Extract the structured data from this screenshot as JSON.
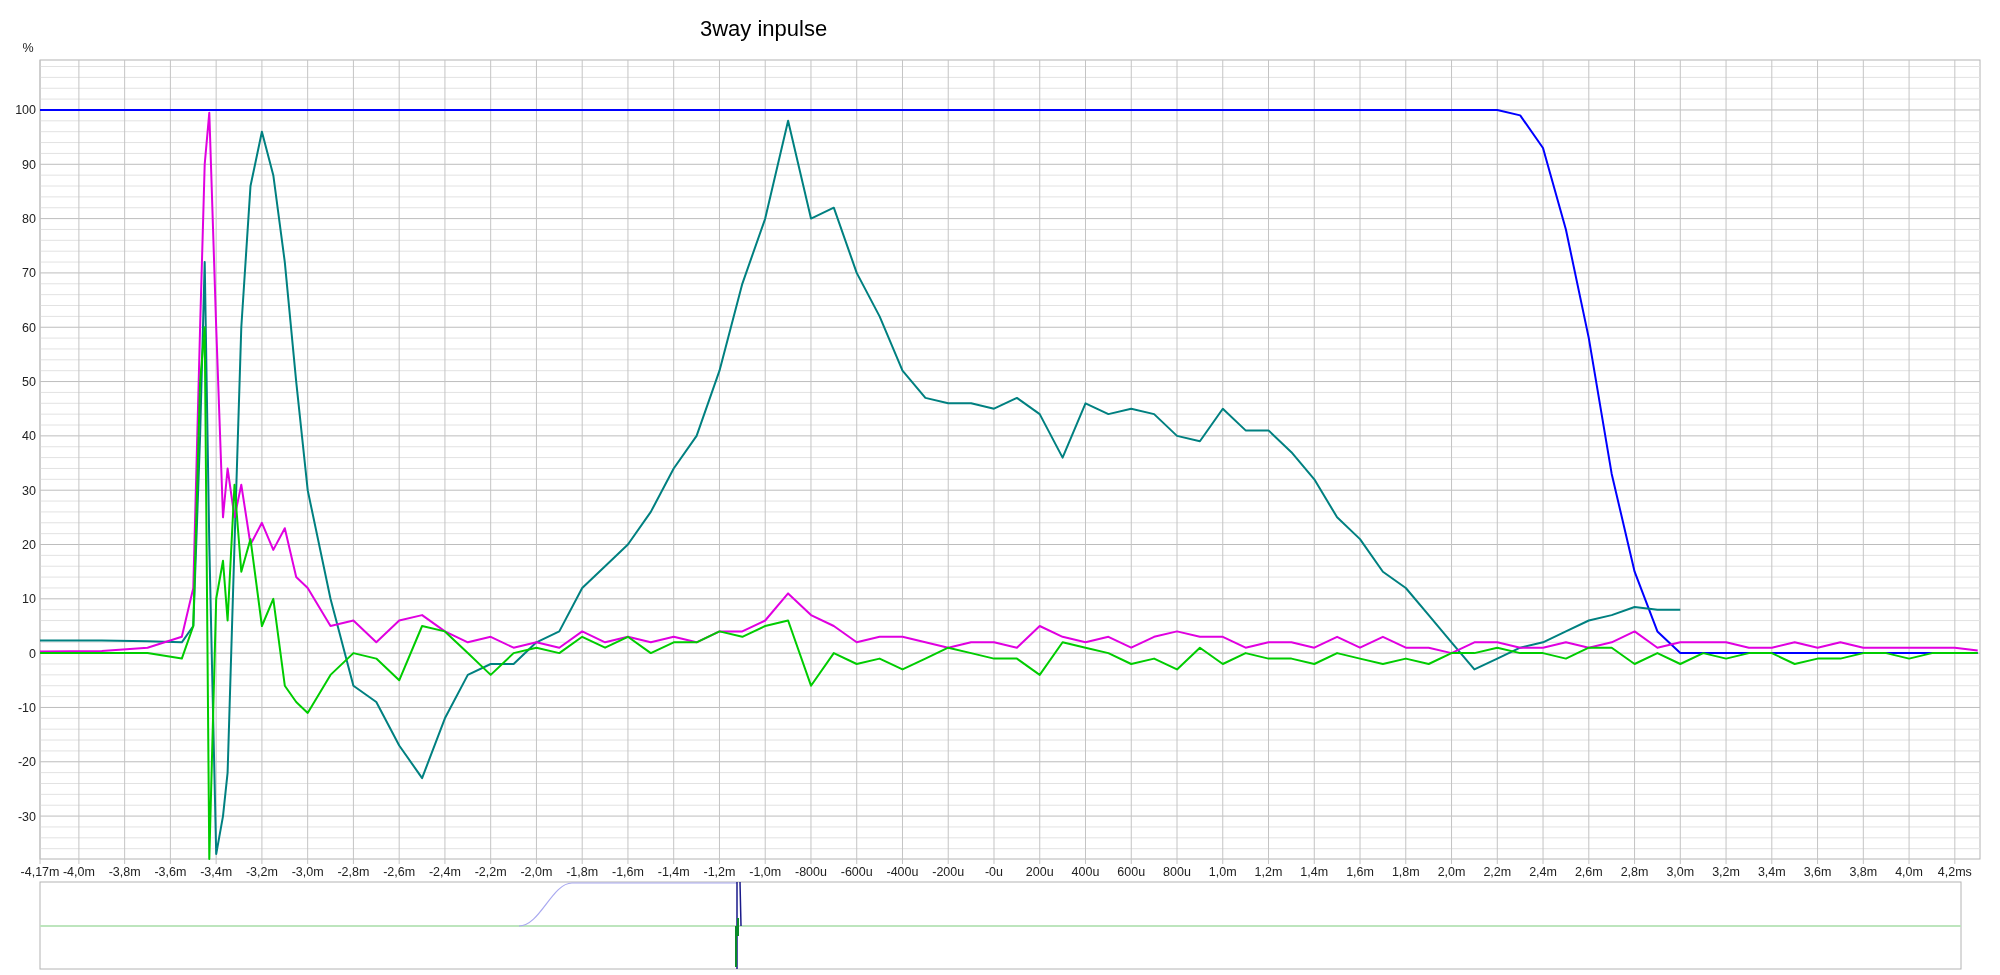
{
  "title": "3way inpulse",
  "chart": {
    "microsecond_tick_labels": [
      "-800u",
      "-600u",
      "-400u",
      "-200u",
      "-0u",
      "200u",
      "400u",
      "600u",
      "800u"
    ],
    "chart_data": {
      "type": "line",
      "ylabel": "%",
      "grid": true,
      "x": [
        -4.17,
        -3.9,
        -3.7,
        -3.55,
        -3.5,
        -3.47,
        -3.45,
        -3.43,
        -3.4,
        -3.37,
        -3.35,
        -3.32,
        -3.29,
        -3.25,
        -3.2,
        -3.15,
        -3.1,
        -3.05,
        -3.0,
        -2.9,
        -2.8,
        -2.7,
        -2.6,
        -2.5,
        -2.4,
        -2.3,
        -2.2,
        -2.1,
        -2.0,
        -1.9,
        -1.8,
        -1.7,
        -1.6,
        -1.5,
        -1.4,
        -1.3,
        -1.2,
        -1.1,
        -1.0,
        -0.9,
        -0.8,
        -0.7,
        -0.6,
        -0.5,
        -0.4,
        -0.3,
        -0.2,
        -0.1,
        0,
        0.1,
        0.2,
        0.3,
        0.4,
        0.5,
        0.6,
        0.7,
        0.8,
        0.9,
        1.0,
        1.1,
        1.2,
        1.3,
        1.4,
        1.5,
        1.6,
        1.7,
        1.8,
        1.9,
        2.0,
        2.1,
        2.2,
        2.3,
        2.4,
        2.5,
        2.6,
        2.7,
        2.8,
        2.9,
        3.0,
        3.1,
        3.2,
        3.3,
        3.4,
        3.5,
        3.6,
        3.7,
        3.8,
        3.9,
        4.0,
        4.1,
        4.2,
        4.3
      ],
      "series": [
        {
          "color": "#0000ff",
          "values": [
            100,
            100,
            100,
            100,
            100,
            100,
            100,
            100,
            100,
            100,
            100,
            100,
            100,
            100,
            100,
            100,
            100,
            100,
            100,
            100,
            100,
            100,
            100,
            100,
            100,
            100,
            100,
            100,
            100,
            100,
            100,
            100,
            100,
            100,
            100,
            100,
            100,
            100,
            100,
            100,
            100,
            100,
            100,
            100,
            100,
            100,
            100,
            100,
            100,
            100,
            100,
            100,
            100,
            100,
            100,
            100,
            100,
            100,
            100,
            100,
            100,
            100,
            100,
            100,
            100,
            100,
            100,
            100,
            100,
            100,
            100,
            99,
            93,
            78,
            58,
            33,
            15,
            4,
            0,
            0,
            0,
            0,
            0,
            0,
            0,
            0,
            0,
            0,
            0,
            0,
            0,
            0
          ]
        },
        {
          "color": "#008080",
          "values": [
            2.3,
            2.3,
            2.2,
            2,
            5,
            40,
            72,
            20,
            -37,
            -30,
            -22,
            20,
            60,
            86,
            96,
            88,
            72,
            50,
            30,
            10,
            -6,
            -9,
            -17,
            -23,
            -12,
            -4,
            -2,
            -2,
            2,
            4,
            12,
            16,
            20,
            26,
            34,
            40,
            52,
            68,
            80,
            98,
            80,
            82,
            70,
            62,
            52,
            47,
            46,
            46,
            45,
            47,
            44,
            36,
            46,
            44,
            45,
            44,
            40,
            39,
            45,
            41,
            41,
            37,
            32,
            25,
            21,
            15,
            12,
            7,
            2,
            -3,
            -1,
            1,
            2,
            4,
            6,
            7,
            8.5,
            8,
            8,
            null,
            null,
            null,
            null,
            null,
            null,
            null,
            null,
            null,
            null,
            null,
            null,
            null
          ]
        },
        {
          "color": "#e000e0",
          "values": [
            0.3,
            0.4,
            1,
            3,
            12,
            60,
            90,
            99.5,
            60,
            25,
            34,
            25,
            31,
            20,
            24,
            19,
            23,
            14,
            12,
            5,
            6,
            2,
            6,
            7,
            4,
            2,
            3,
            1,
            2,
            1,
            4,
            2,
            3,
            2,
            3,
            2,
            4,
            4,
            6,
            11,
            7,
            5,
            2,
            3,
            3,
            2,
            1,
            2,
            2,
            1,
            5,
            3,
            2,
            3,
            1,
            3,
            4,
            3,
            3,
            1,
            2,
            2,
            1,
            3,
            1,
            3,
            1,
            1,
            0,
            2,
            2,
            1,
            1,
            2,
            1,
            2,
            4,
            1,
            2,
            2,
            2,
            1,
            1,
            2,
            1,
            2,
            1,
            1,
            1,
            1,
            1,
            0.5
          ]
        },
        {
          "color": "#00cc00",
          "values": [
            0,
            0,
            0,
            -1,
            5,
            50,
            60,
            -37.9,
            10,
            17,
            6,
            31,
            15,
            21,
            5,
            10,
            -6,
            -9,
            -11,
            -4,
            0,
            -1,
            -5,
            5,
            4,
            0,
            -4,
            0,
            1,
            0,
            3,
            1,
            3,
            0,
            2,
            2,
            4,
            3,
            5,
            6,
            -6,
            0,
            -2,
            -1,
            -3,
            -1,
            1,
            0,
            -1,
            -1,
            -4,
            2,
            1,
            0,
            -2,
            -1,
            -3,
            1,
            -2,
            0,
            -1,
            -1,
            -2,
            0,
            -1,
            -2,
            -1,
            -2,
            0,
            0,
            1,
            0,
            0,
            -1,
            1,
            1,
            -2,
            0,
            -2,
            0,
            -1,
            0,
            0,
            -2,
            -1,
            -1,
            0,
            0,
            -1,
            0,
            0,
            0
          ]
        }
      ],
      "xlim": [
        -4.17,
        4.31
      ],
      "ylim": [
        -37.9,
        109.2
      ],
      "xticks": [
        {
          "value": -4.17,
          "label": "-4,17m"
        },
        {
          "value": -4.0,
          "label": "-4,0m"
        },
        {
          "value": -3.8,
          "label": "-3,8m"
        },
        {
          "value": -3.6,
          "label": "-3,6m"
        },
        {
          "value": -3.4,
          "label": "-3,4m"
        },
        {
          "value": -3.2,
          "label": "-3,2m"
        },
        {
          "value": -3.0,
          "label": "-3,0m"
        },
        {
          "value": -2.8,
          "label": "-2,8m"
        },
        {
          "value": -2.6,
          "label": "-2,6m"
        },
        {
          "value": -2.4,
          "label": "-2,4m"
        },
        {
          "value": -2.2,
          "label": "-2,2m"
        },
        {
          "value": -2.0,
          "label": "-2,0m"
        },
        {
          "value": -1.8,
          "label": "-1,8m"
        },
        {
          "value": -1.6,
          "label": "-1,6m"
        },
        {
          "value": -1.4,
          "label": "-1,4m"
        },
        {
          "value": -1.2,
          "label": "-1,2m"
        },
        {
          "value": -1.0,
          "label": "-1,0m"
        },
        {
          "value": 1.0,
          "label": "1,0m"
        },
        {
          "value": 1.2,
          "label": "1,2m"
        },
        {
          "value": 1.4,
          "label": "1,4m"
        },
        {
          "value": 1.6,
          "label": "1,6m"
        },
        {
          "value": 1.8,
          "label": "1,8m"
        },
        {
          "value": 2.0,
          "label": "2,0m"
        },
        {
          "value": 2.2,
          "label": "2,2m"
        },
        {
          "value": 2.4,
          "label": "2,4m"
        },
        {
          "value": 2.6,
          "label": "2,6m"
        },
        {
          "value": 2.8,
          "label": "2,8m"
        },
        {
          "value": 3.0,
          "label": "3,0m"
        },
        {
          "value": 3.2,
          "label": "3,2m"
        },
        {
          "value": 3.4,
          "label": "3,4m"
        },
        {
          "value": 3.6,
          "label": "3,6m"
        },
        {
          "value": 3.8,
          "label": "3,8m"
        },
        {
          "value": 4.0,
          "label": "4,0m"
        },
        {
          "value": 4.2,
          "label": "4,2ms"
        }
      ],
      "yticks": [
        -30,
        -20,
        -10,
        0,
        10,
        20,
        30,
        40,
        50,
        60,
        70,
        80,
        90,
        100
      ]
    }
  }
}
